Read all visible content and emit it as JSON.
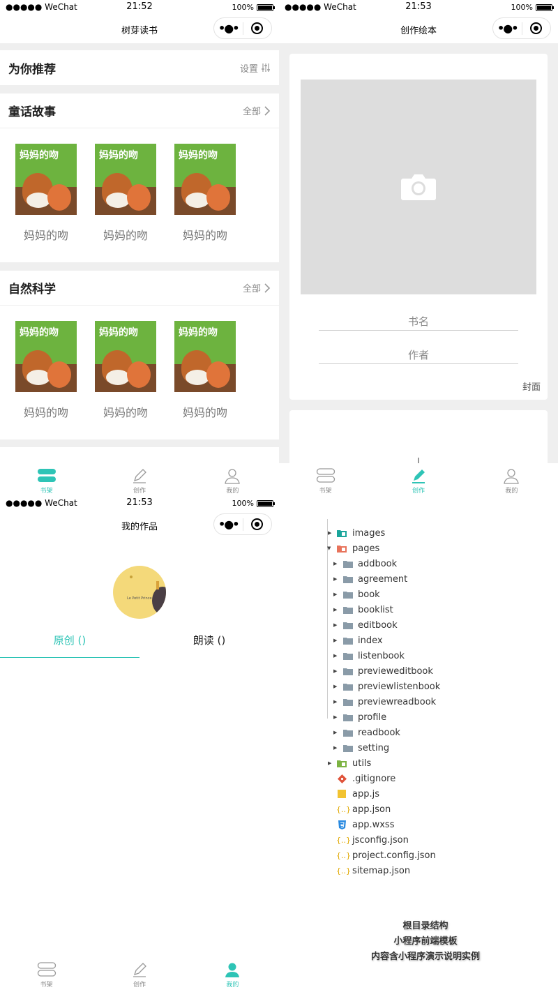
{
  "status": {
    "carrier": "●●●●● WeChat",
    "battery": "100%",
    "time1": "21:52",
    "time2": "21:53",
    "time3": "21:53"
  },
  "screen1": {
    "title": "树芽读书",
    "recommend": {
      "heading": "为你推荐",
      "action": "设置"
    },
    "sections": [
      {
        "heading": "童话故事",
        "more": "全部",
        "books": [
          "妈妈的吻",
          "妈妈的吻",
          "妈妈的吻"
        ]
      },
      {
        "heading": "自然科学",
        "more": "全部",
        "books": [
          "妈妈的吻",
          "妈妈的吻",
          "妈妈的吻"
        ]
      }
    ],
    "cover_title": "妈妈的吻"
  },
  "screen2": {
    "title": "创作绘本",
    "book_name_placeholder": "书名",
    "author_placeholder": "作者",
    "cover_label": "封面"
  },
  "screen3": {
    "title": "我的作品",
    "tab_original": "原创 ()",
    "tab_reading": "朗读 ()",
    "avatar_text": "Le Petit Prince"
  },
  "tabs": {
    "bookshelf": "书架",
    "create": "创作",
    "mine": "我的"
  },
  "colors": {
    "accent": "#2ec4b6",
    "folder": "#8a9ba8"
  },
  "tree": {
    "images": "images",
    "pages": "pages",
    "page_folders": [
      "addbook",
      "agreement",
      "book",
      "booklist",
      "editbook",
      "index",
      "listenbook",
      "previeweditbook",
      "previewlistenbook",
      "previewreadbook",
      "profile",
      "readbook",
      "setting"
    ],
    "utils": "utils",
    "files": [
      ".gitignore",
      "app.js",
      "app.json",
      "app.wxss",
      "jsconfig.json",
      "project.config.json",
      "sitemap.json"
    ]
  },
  "notes": [
    "根目录结构",
    "小程序前端模板",
    "内容含小程序演示说明实例"
  ]
}
